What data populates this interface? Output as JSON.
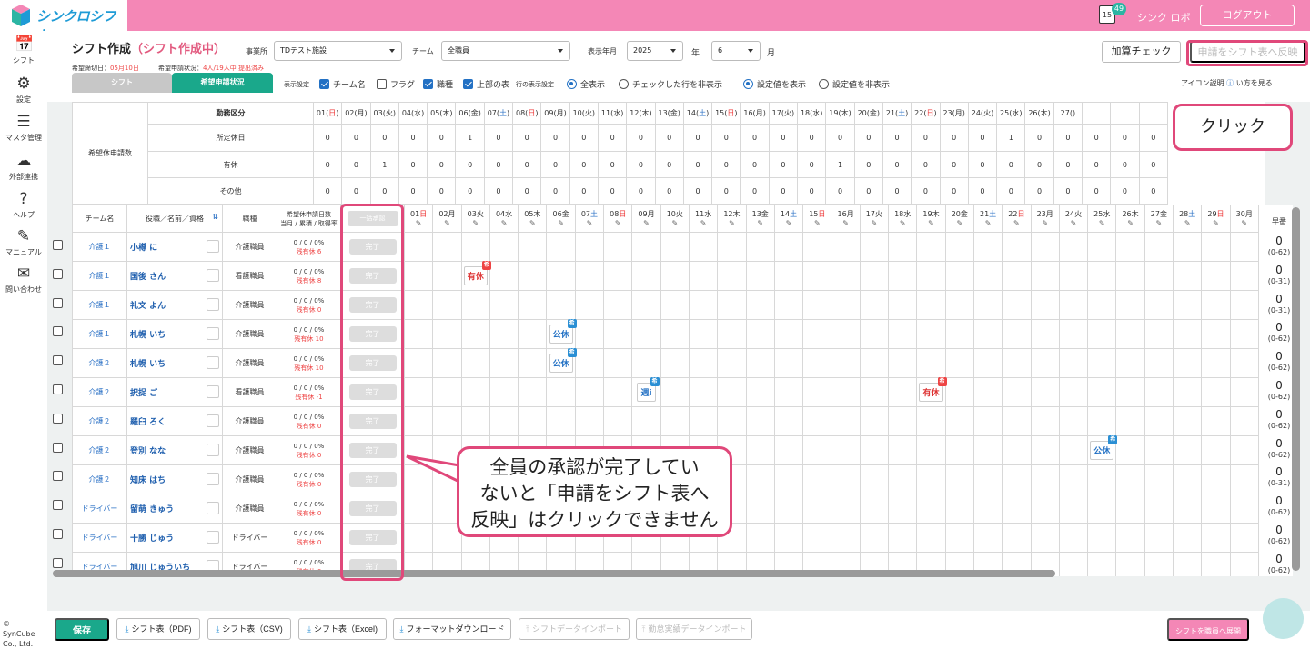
{
  "header": {
    "logo": "シンクロシフト",
    "cal_badge": "49",
    "cal_num": "15",
    "user": "シンク ロボ",
    "logout": "ログアウト"
  },
  "nav": [
    {
      "label": "シフト",
      "icon": "calendar-icon"
    },
    {
      "label": "設定",
      "icon": "gear-icon"
    },
    {
      "label": "マスタ管理",
      "icon": "database-icon"
    },
    {
      "label": "外部連携",
      "icon": "cloud-icon"
    },
    {
      "label": "ヘルプ",
      "icon": "help-icon"
    },
    {
      "label": "マニュアル",
      "icon": "manual-icon"
    },
    {
      "label": "問い合わせ",
      "icon": "mail-icon"
    }
  ],
  "copyright": "© SynCube Co., Ltd.",
  "title": "シフト作成",
  "title_status": "（シフト作成中）",
  "deadline_label": "希望締切日：",
  "deadline_value": "05月10日",
  "apply_label": "希望申請状況：",
  "apply_value": "4人/19人中 提出済み",
  "filters": {
    "office_label": "事業所",
    "office": "TDテスト施設",
    "team_label": "チーム",
    "team": "全職員",
    "ym_label": "表示年月",
    "year": "2025",
    "year_unit": "年",
    "month": "6",
    "month_unit": "月"
  },
  "buttons": {
    "check": "加算チェック",
    "reflect": "申請をシフト表へ反映"
  },
  "tabs": [
    "シフト",
    "希望申請状況"
  ],
  "options": {
    "display_label": "表示設定",
    "team_name": "チーム名",
    "flag": "フラグ",
    "job": "職種",
    "top_table": "上部の表",
    "row_label": "行の表示設定",
    "show_all": "全表示",
    "hide_checked": "チェックした行を非表示",
    "show_setting": "設定値を表示",
    "hide_setting": "設定値を非表示"
  },
  "icon_help": "アイコン説明",
  "icon_help_tail": "い方を見る",
  "summary": {
    "header": "勤務区分",
    "label": "希望休申請数",
    "rows": [
      {
        "name": "所定休日",
        "vals": [
          "0",
          "0",
          "0",
          "0",
          "0",
          "1",
          "0",
          "0",
          "0",
          "0",
          "0",
          "0",
          "0",
          "0",
          "0",
          "0",
          "0",
          "0",
          "0",
          "0",
          "0",
          "0",
          "0",
          "0",
          "1",
          "0",
          "0",
          "0",
          "0",
          "0"
        ]
      },
      {
        "name": "有休",
        "vals": [
          "0",
          "0",
          "1",
          "0",
          "0",
          "0",
          "0",
          "0",
          "0",
          "0",
          "0",
          "0",
          "0",
          "0",
          "0",
          "0",
          "0",
          "0",
          "1",
          "0",
          "0",
          "0",
          "0",
          "0",
          "0",
          "0",
          "0",
          "0",
          "0",
          "0"
        ]
      },
      {
        "name": "その他",
        "vals": [
          "0",
          "0",
          "0",
          "0",
          "0",
          "0",
          "0",
          "0",
          "0",
          "0",
          "0",
          "0",
          "0",
          "0",
          "0",
          "0",
          "0",
          "0",
          "0",
          "0",
          "0",
          "0",
          "0",
          "0",
          "0",
          "0",
          "0",
          "0",
          "0",
          "0"
        ]
      }
    ]
  },
  "days_top": [
    {
      "d": "01(",
      "w": "日",
      "t": "sun"
    },
    {
      "d": "02(",
      "w": "月",
      "t": ""
    },
    {
      "d": "03(",
      "w": "火",
      "t": ""
    },
    {
      "d": "04(",
      "w": "水",
      "t": ""
    },
    {
      "d": "05(",
      "w": "木",
      "t": ""
    },
    {
      "d": "06(",
      "w": "金",
      "t": ""
    },
    {
      "d": "07(",
      "w": "土",
      "t": "sat"
    },
    {
      "d": "08(",
      "w": "日",
      "t": "sun"
    },
    {
      "d": "09(",
      "w": "月",
      "t": ""
    },
    {
      "d": "10(",
      "w": "火",
      "t": ""
    },
    {
      "d": "11(",
      "w": "水",
      "t": ""
    },
    {
      "d": "12(",
      "w": "木",
      "t": ""
    },
    {
      "d": "13(",
      "w": "金",
      "t": ""
    },
    {
      "d": "14(",
      "w": "土",
      "t": "sat"
    },
    {
      "d": "15(",
      "w": "日",
      "t": "sun"
    },
    {
      "d": "16(",
      "w": "月",
      "t": ""
    },
    {
      "d": "17(",
      "w": "火",
      "t": ""
    },
    {
      "d": "18(",
      "w": "水",
      "t": ""
    },
    {
      "d": "19(",
      "w": "木",
      "t": ""
    },
    {
      "d": "20(",
      "w": "金",
      "t": ""
    },
    {
      "d": "21(",
      "w": "土",
      "t": "sat"
    },
    {
      "d": "22(",
      "w": "日",
      "t": "sun"
    },
    {
      "d": "23(",
      "w": "月",
      "t": ""
    },
    {
      "d": "24(",
      "w": "火",
      "t": ""
    },
    {
      "d": "25(",
      "w": "水",
      "t": ""
    },
    {
      "d": "26(",
      "w": "木",
      "t": ""
    },
    {
      "d": "27(",
      "w": "",
      "t": ""
    },
    {
      "d": "",
      "w": "",
      "t": ""
    },
    {
      "d": "",
      "w": "",
      "t": ""
    },
    {
      "d": "",
      "w": "",
      "t": ""
    }
  ],
  "days": [
    {
      "d": "01",
      "w": "日",
      "t": "sun"
    },
    {
      "d": "02",
      "w": "月",
      "t": ""
    },
    {
      "d": "03",
      "w": "火",
      "t": ""
    },
    {
      "d": "04",
      "w": "水",
      "t": ""
    },
    {
      "d": "05",
      "w": "木",
      "t": ""
    },
    {
      "d": "06",
      "w": "金",
      "t": ""
    },
    {
      "d": "07",
      "w": "土",
      "t": "sat"
    },
    {
      "d": "08",
      "w": "日",
      "t": "sun"
    },
    {
      "d": "09",
      "w": "月",
      "t": ""
    },
    {
      "d": "10",
      "w": "火",
      "t": ""
    },
    {
      "d": "11",
      "w": "水",
      "t": ""
    },
    {
      "d": "12",
      "w": "木",
      "t": ""
    },
    {
      "d": "13",
      "w": "金",
      "t": ""
    },
    {
      "d": "14",
      "w": "土",
      "t": "sat"
    },
    {
      "d": "15",
      "w": "日",
      "t": "sun"
    },
    {
      "d": "16",
      "w": "月",
      "t": ""
    },
    {
      "d": "17",
      "w": "火",
      "t": ""
    },
    {
      "d": "18",
      "w": "水",
      "t": ""
    },
    {
      "d": "19",
      "w": "木",
      "t": ""
    },
    {
      "d": "20",
      "w": "金",
      "t": ""
    },
    {
      "d": "21",
      "w": "土",
      "t": "sat"
    },
    {
      "d": "22",
      "w": "日",
      "t": "sun"
    },
    {
      "d": "23",
      "w": "月",
      "t": ""
    },
    {
      "d": "24",
      "w": "火",
      "t": ""
    },
    {
      "d": "25",
      "w": "水",
      "t": ""
    },
    {
      "d": "26",
      "w": "木",
      "t": ""
    },
    {
      "d": "27",
      "w": "金",
      "t": ""
    },
    {
      "d": "28",
      "w": "土",
      "t": "sat"
    },
    {
      "d": "29",
      "w": "日",
      "t": "sun"
    },
    {
      "d": "30",
      "w": "月",
      "t": ""
    }
  ],
  "table_headers": {
    "team": "チーム名",
    "name": "役職／名前／資格",
    "job": "職種",
    "count": "希望休申請日数",
    "count2": "当月 / 累積 / 取得率",
    "bulk": "一括承認",
    "right": "早番"
  },
  "count_text": "0 / 0 / 0%",
  "remain_label": "残有休",
  "done_label": "完了",
  "employees": [
    {
      "team": "介護１",
      "name": "小樽 に",
      "job": "介護職員",
      "remain": "6",
      "right_v": "0",
      "right_s": "(0-62)"
    },
    {
      "team": "介護１",
      "name": "国後 さん",
      "job": "看護職員",
      "remain": "8",
      "right_v": "0",
      "right_s": "(0-31)"
    },
    {
      "team": "介護１",
      "name": "礼文 よん",
      "job": "介護職員",
      "remain": "0",
      "right_v": "0",
      "right_s": "(0-31)"
    },
    {
      "team": "介護１",
      "name": "札幌 いち",
      "job": "介護職員",
      "remain": "10",
      "right_v": "0",
      "right_s": "(0-62)"
    },
    {
      "team": "介護２",
      "name": "札幌 いち",
      "job": "介護職員",
      "remain": "10",
      "right_v": "0",
      "right_s": "(0-62)"
    },
    {
      "team": "介護２",
      "name": "択捉 ご",
      "job": "看護職員",
      "remain": "-1",
      "right_v": "0",
      "right_s": "(0-62)"
    },
    {
      "team": "介護２",
      "name": "羅臼 ろく",
      "job": "介護職員",
      "remain": "0",
      "right_v": "0",
      "right_s": "(0-62)"
    },
    {
      "team": "介護２",
      "name": "登別 なな",
      "job": "介護職員",
      "remain": "0",
      "right_v": "0",
      "right_s": "(0-62)"
    },
    {
      "team": "介護２",
      "name": "知床 はち",
      "job": "介護職員",
      "remain": "0",
      "right_v": "0",
      "right_s": "(0-31)"
    },
    {
      "team": "ドライバー",
      "name": "留萌 きゅう",
      "job": "介護職員",
      "remain": "0",
      "right_v": "0",
      "right_s": "(0-62)"
    },
    {
      "team": "ドライバー",
      "name": "十勝 じゅう",
      "job": "ドライバー",
      "remain": "0",
      "right_v": "0",
      "right_s": "(0-62)"
    },
    {
      "team": "ドライバー",
      "name": "旭川 じゅういち",
      "job": "ドライバー",
      "remain": "0",
      "right_v": "0",
      "right_s": "(0-62)"
    }
  ],
  "requests": [
    {
      "row": 1,
      "day": 3,
      "label": "有休",
      "kind": "pto",
      "badge": "希"
    },
    {
      "row": 3,
      "day": 6,
      "label": "公休",
      "kind": "pub",
      "badge": "希"
    },
    {
      "row": 4,
      "day": 6,
      "label": "公休",
      "kind": "pub",
      "badge": "希"
    },
    {
      "row": 5,
      "day": 9,
      "label": "週i",
      "kind": "pub",
      "badge": "希"
    },
    {
      "row": 5,
      "day": 19,
      "label": "有休",
      "kind": "pto",
      "badge": "希"
    },
    {
      "row": 7,
      "day": 25,
      "label": "公休",
      "kind": "pub",
      "badge": "希"
    }
  ],
  "callouts": {
    "click": "クリック",
    "line1": "全員の承認が完了してい",
    "line2": "ないと「申請をシフト表へ",
    "line3": "反映」はクリックできません"
  },
  "bottom": {
    "save": "保存",
    "pdf": "シフト表（PDF)",
    "csv": "シフト表（CSV)",
    "excel": "シフト表（Excel)",
    "format": "フォーマットダウンロード",
    "import": "シフトデータインポート",
    "attendance": "勤怠実績データインポート",
    "deploy": "シフトを職員へ展開"
  },
  "colors": {
    "brand_pink": "#f487b6",
    "accent_green": "#1aa88b",
    "highlight": "#e0487a",
    "link_blue": "#1f5fae"
  }
}
